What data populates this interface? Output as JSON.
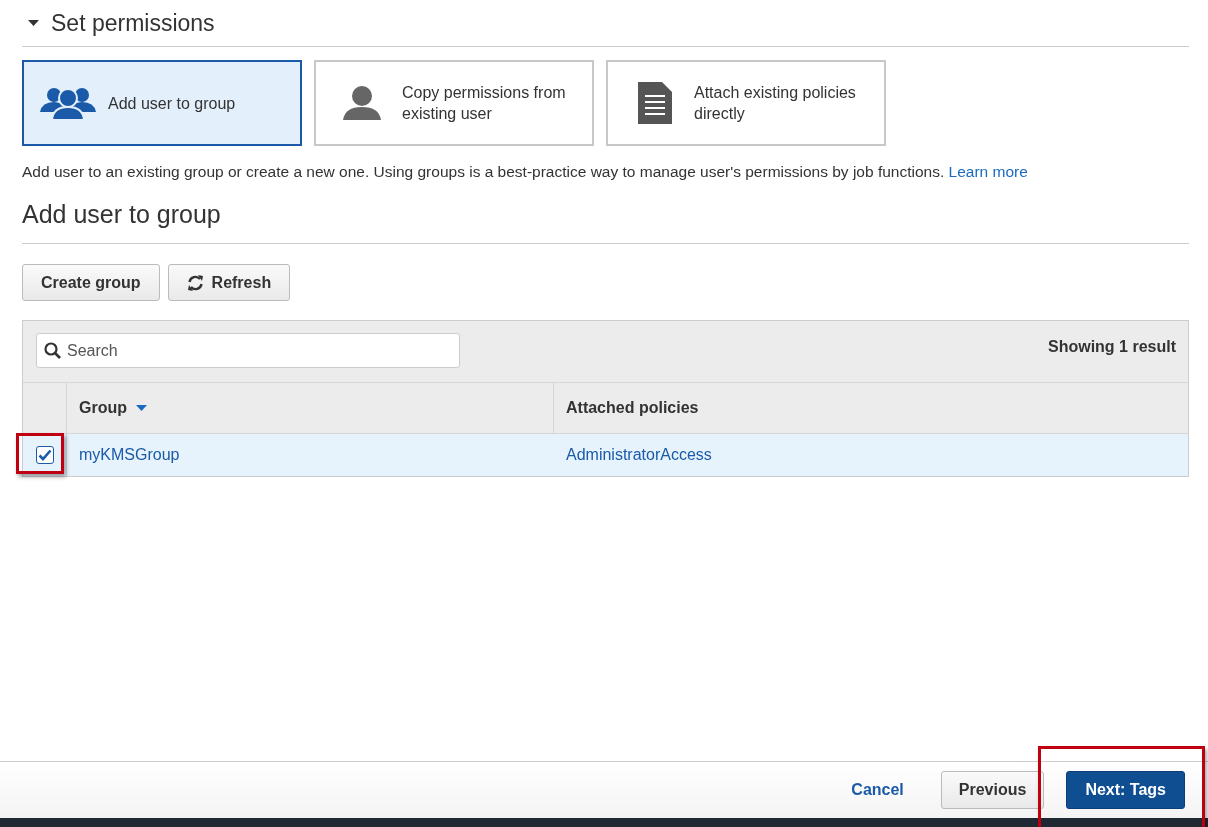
{
  "section": {
    "title": "Set permissions",
    "expanded": true
  },
  "options": [
    {
      "kind": "group",
      "label": "Add user to group",
      "selected": true
    },
    {
      "kind": "user",
      "label": "Copy permissions from existing user",
      "selected": false
    },
    {
      "kind": "policy",
      "label": "Attach existing policies directly",
      "selected": false
    }
  ],
  "description": {
    "text": "Add user to an existing group or create a new one. Using groups is a best-practice way to manage user's permissions by job functions.",
    "link": "Learn more"
  },
  "group_panel": {
    "title": "Add user to group",
    "buttons": [
      {
        "kind": "plain",
        "label": "Create group"
      },
      {
        "kind": "refresh",
        "label": "Refresh"
      }
    ],
    "search": {
      "placeholder": "Search"
    },
    "result_count": "Showing 1 result",
    "columns": [
      {
        "label": "Group",
        "sorted": true
      },
      {
        "label": "Attached policies",
        "sorted": false
      }
    ],
    "rows": [
      {
        "selected": true,
        "highlighted": true,
        "group": "myKMSGroup",
        "policies": "AdministratorAccess"
      }
    ]
  },
  "footer": {
    "buttons": [
      {
        "kind": "link",
        "label": "Cancel",
        "highlighted": false
      },
      {
        "kind": "secondary",
        "label": "Previous",
        "highlighted": false
      },
      {
        "kind": "primary",
        "label": "Next: Tags",
        "highlighted": true
      }
    ]
  }
}
